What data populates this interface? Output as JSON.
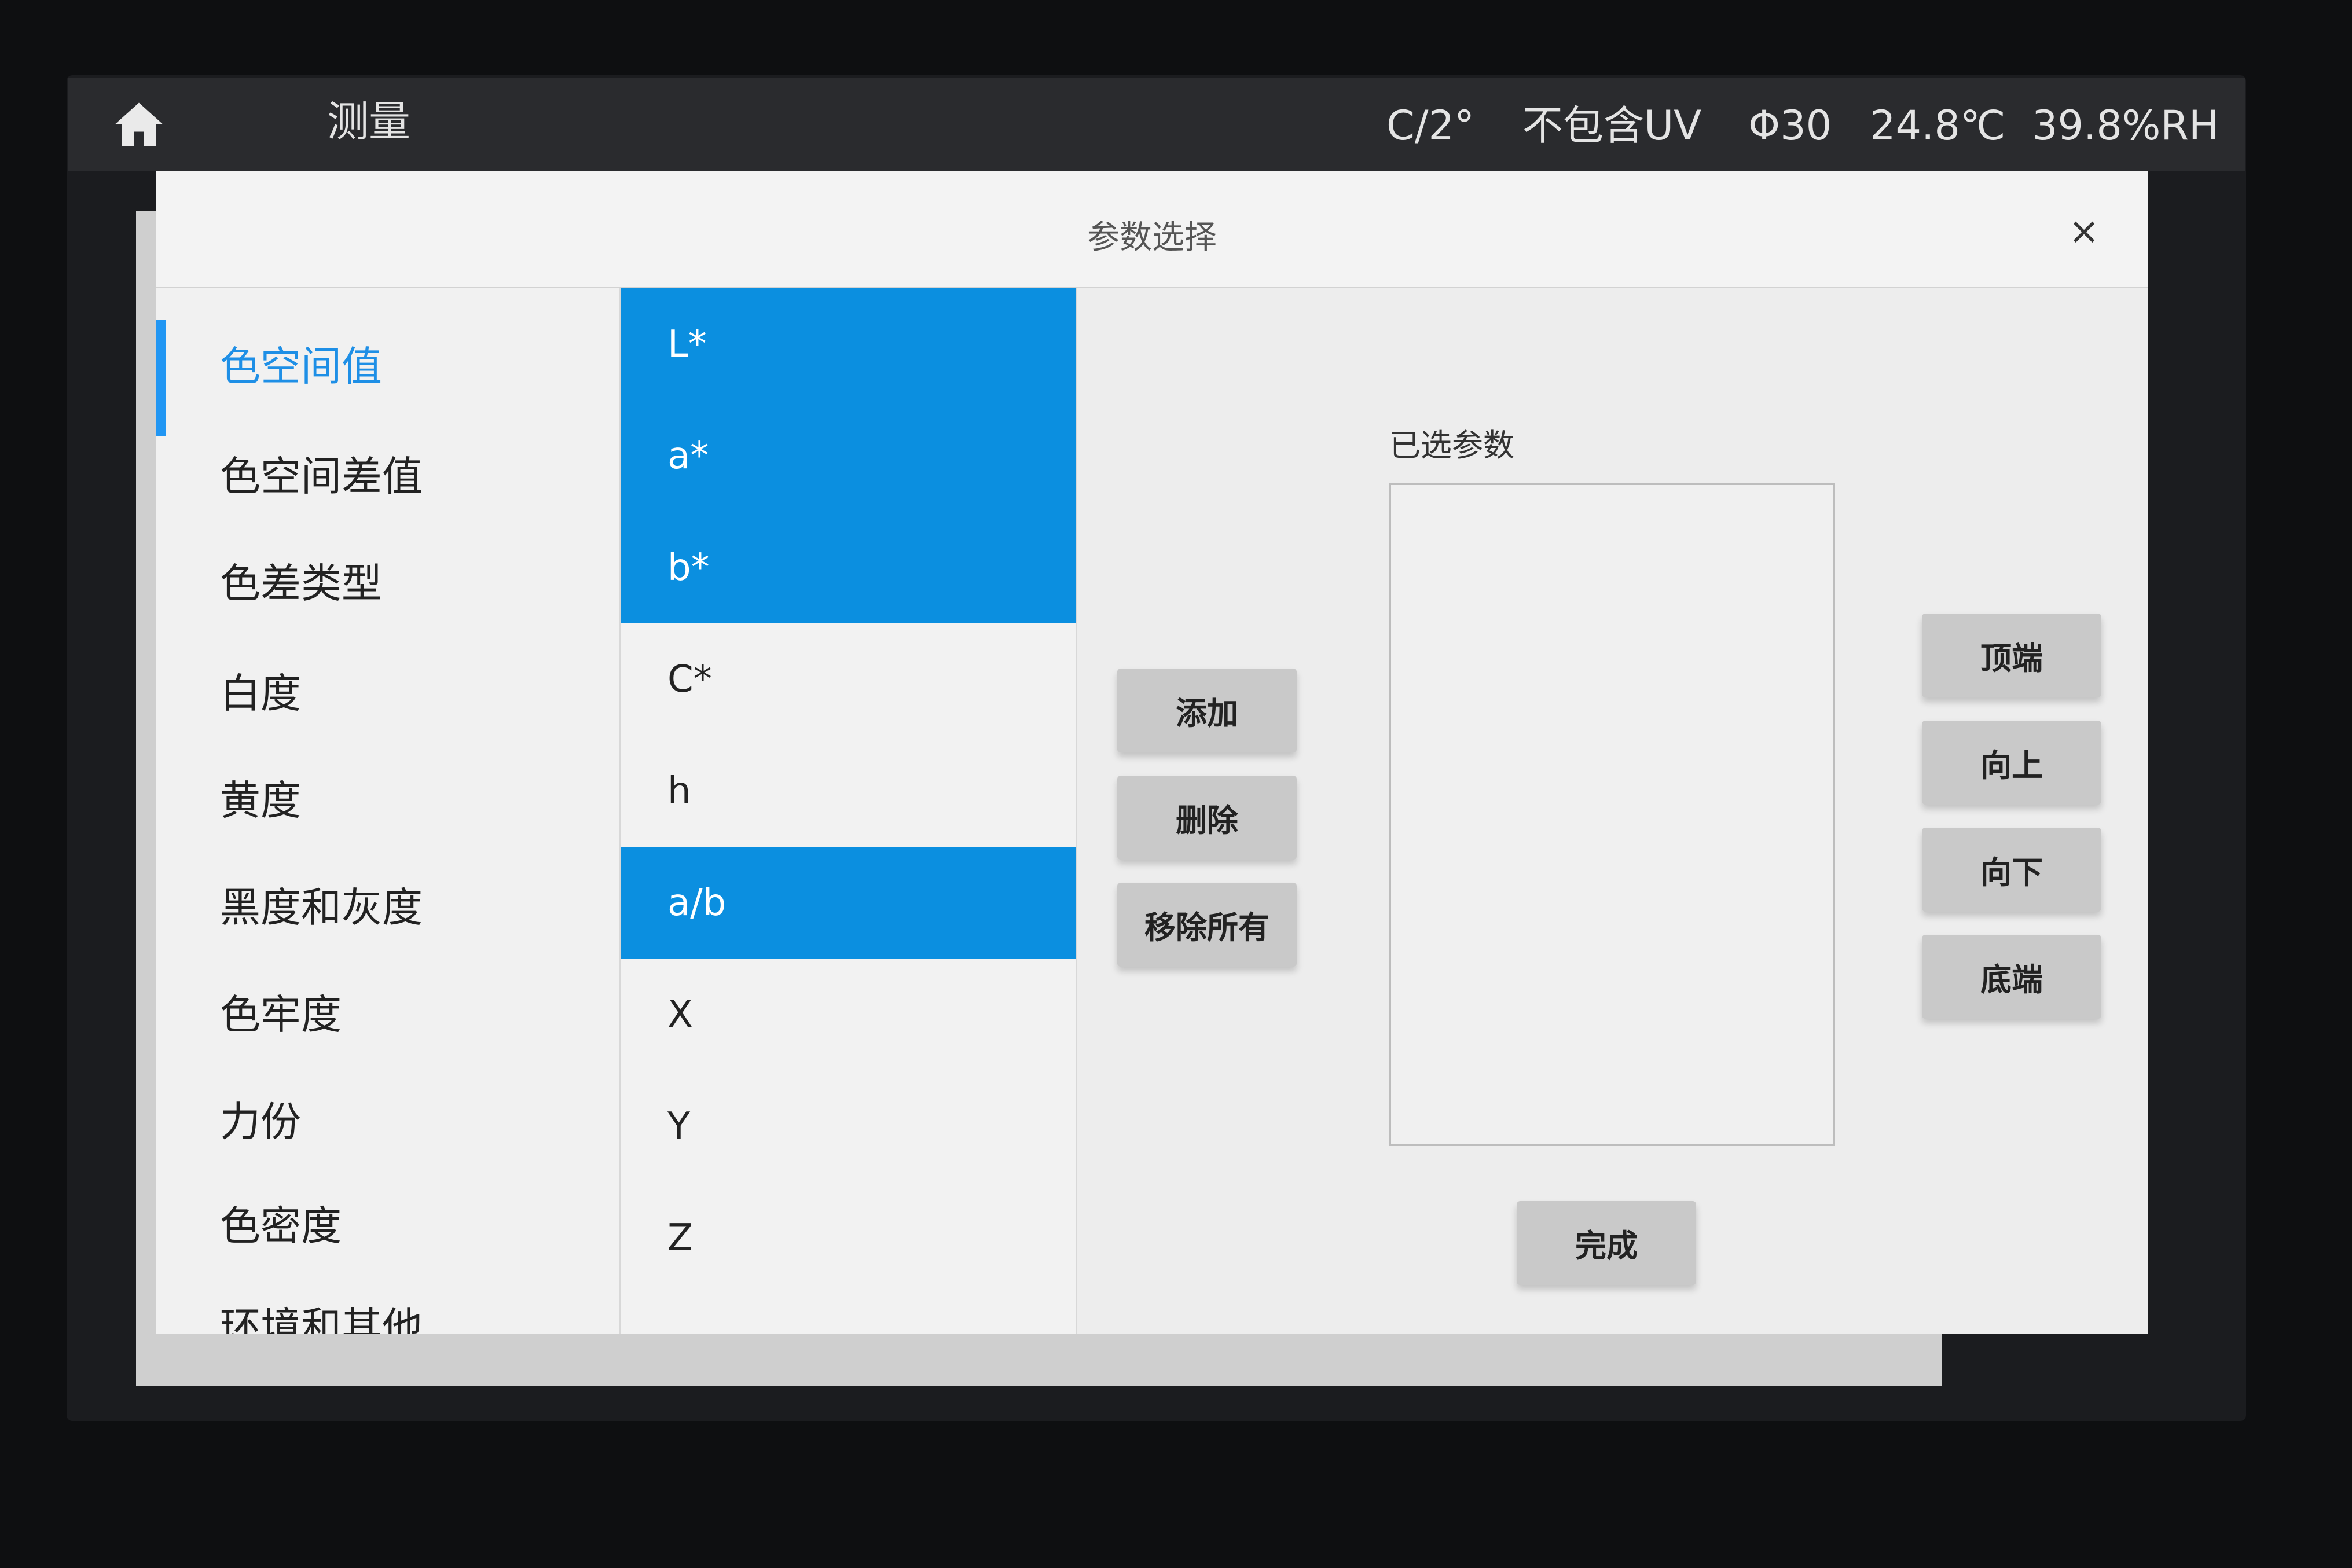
{
  "statusbar": {
    "title": "测量",
    "illuminant": "C/2°",
    "uv_mode": "不包含UV",
    "aperture": "Φ30",
    "temperature": "24.8℃",
    "humidity": "39.8%RH"
  },
  "dialog": {
    "title": "参数选择",
    "close_label": "×"
  },
  "categories": [
    {
      "label": "色空间值",
      "active": true
    },
    {
      "label": "色空间差值"
    },
    {
      "label": "色差类型"
    },
    {
      "label": "白度"
    },
    {
      "label": "黄度"
    },
    {
      "label": "黑度和灰度"
    },
    {
      "label": "色牢度"
    },
    {
      "label": "力份"
    },
    {
      "label": "色密度"
    },
    {
      "label": "环境和其他"
    }
  ],
  "parameters": [
    {
      "label": "L*",
      "selected": true
    },
    {
      "label": "a*",
      "selected": true
    },
    {
      "label": "b*",
      "selected": true
    },
    {
      "label": "C*",
      "selected": false
    },
    {
      "label": "h",
      "selected": false
    },
    {
      "label": "a/b",
      "selected": true
    },
    {
      "label": "X",
      "selected": false
    },
    {
      "label": "Y",
      "selected": false
    },
    {
      "label": "Z",
      "selected": false
    }
  ],
  "actions": {
    "add": "添加",
    "delete": "删除",
    "remove_all": "移除所有"
  },
  "selected_panel": {
    "label": "已选参数",
    "items": []
  },
  "order_buttons": {
    "top": "顶端",
    "up": "向上",
    "down": "向下",
    "bottom": "底端"
  },
  "done_label": "完成",
  "colors": {
    "accent": "#1e8fe6",
    "selection": "#0b8fe0"
  },
  "icons": {
    "home": "home-icon",
    "close": "close-icon"
  }
}
